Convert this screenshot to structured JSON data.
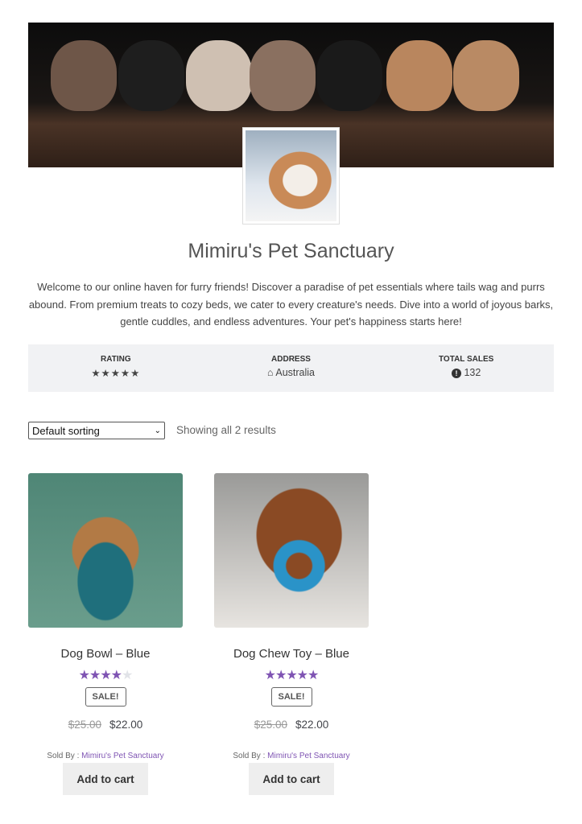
{
  "store": {
    "name": "Mimiru's Pet Sanctuary",
    "description": "Welcome to our online haven for furry friends! Discover a paradise of pet essentials where tails wag and purrs abound. From premium treats to cozy beds, we cater to every creature's needs. Dive into a world of joyous barks, gentle cuddles, and endless adventures. Your pet's happiness starts here!"
  },
  "stats": {
    "rating_label": "RATING",
    "rating_stars": "★★★★★",
    "rating_value": 5,
    "address_label": "ADDRESS",
    "address_icon": "home-icon",
    "address": "Australia",
    "sales_label": "TOTAL SALES",
    "sales_icon": "info-circle-icon",
    "sales": "132"
  },
  "toolbar": {
    "sort_selected": "Default sorting",
    "result_count": "Showing all 2 results"
  },
  "colors": {
    "accent": "#7f54b3",
    "stats_bg": "#f1f2f4"
  },
  "products": [
    {
      "name": "Dog Bowl – Blue",
      "rating": 4,
      "stars_filled": "★★★★",
      "stars_empty": "★",
      "badge": "SALE!",
      "old_price": "$25.00",
      "price": "$22.00",
      "sold_by_label": "Sold By :",
      "vendor": "Mimiru's Pet Sanctuary",
      "button": "Add to cart"
    },
    {
      "name": "Dog Chew Toy – Blue",
      "rating": 5,
      "stars_filled": "★★★★★",
      "stars_empty": "",
      "badge": "SALE!",
      "old_price": "$25.00",
      "price": "$22.00",
      "sold_by_label": "Sold By :",
      "vendor": "Mimiru's Pet Sanctuary",
      "button": "Add to cart"
    }
  ]
}
